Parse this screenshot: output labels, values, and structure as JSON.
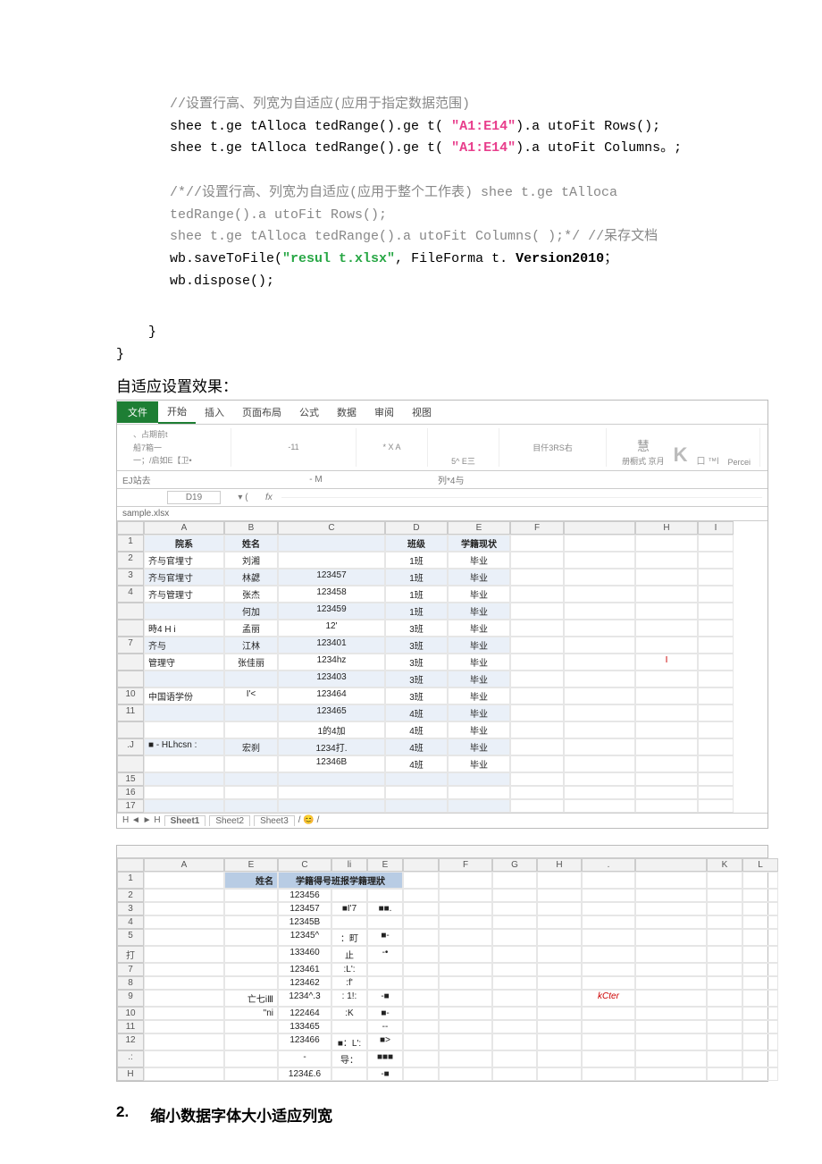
{
  "code": {
    "c1": "//设置行高、列宽为自适应(应用于指定数据范围)",
    "c2a": "shee t.ge tAlloca tedRange().ge t( ",
    "c2s": "\"A1:E14\"",
    "c2b": ").a utoFit Rows();",
    "c3a": "shee t.ge tAlloca tedRange().ge t( ",
    "c3s": "\"A1:E14\"",
    "c3b": ").a utoFit Columns。;",
    "c4a": "/*//设置行高、列宽为自适应(应用于整个工作表) shee t.ge tAlloca",
    "c4b": "tedRange().a utoFit Rows();",
    "c4c": "shee t.ge tAlloca tedRange().a utoFit Columns( );*/",
    "c4d": " //呆存文档",
    "c5a": "wb.saveToFile(",
    "c5s": "\"resul t.xlsx\"",
    "c5b": ", FileForma t. ",
    "c5c": "Version2010",
    "c5d": "；",
    "c6": "wb.dispose();",
    "brace1": "    }",
    "brace2": "}"
  },
  "effect_title": "自适应设置效果：",
  "ribbon": {
    "tabs": [
      "文件",
      "开始",
      "插入",
      "页面布局",
      "公式",
      "数据",
      "审阅",
      "视图"
    ],
    "grp1a": "、占期前t",
    "grp1b": "船7箱一",
    "grp1c": "一；/启如E【卫•",
    "font_size": "-11",
    "bold_marker": "* X A",
    "center": "5^ E三",
    "right1": "目仟3RS右",
    "style1": "慧",
    "styleK": "K",
    "style2": "册橱式  京月",
    "percei": "Percei",
    "little_sq": "口 ™l"
  },
  "fxrow": {
    "left": "EJ站去",
    "mid": "- M",
    "right": "列*4与"
  },
  "namebox": "D19",
  "fx_symbol": "fx",
  "filetab": "sample.xlsx",
  "grid1": {
    "cols": [
      "",
      "A",
      "B",
      "C",
      "D",
      "E",
      "F",
      "",
      "H",
      "I"
    ],
    "rows": [
      {
        "n": "1",
        "a": "院系",
        "b": "姓名",
        "c": "",
        "d": "班级",
        "e": "学籍现状",
        "hdr": true
      },
      {
        "n": "2",
        "a": "齐与官埋寸",
        "b": "刘湘",
        "c": "",
        "d": "1班",
        "e": "毕业"
      },
      {
        "n": "3",
        "a": "齐与官埋寸",
        "b": "林勰",
        "c": "123457",
        "d": "1班",
        "e": "毕业"
      },
      {
        "n": "4",
        "a": "齐与管理寸",
        "b": "张杰",
        "c": "123458",
        "d": "1班",
        "e": "毕业"
      },
      {
        "n": "",
        "a": "",
        "b": "何加",
        "c": "123459",
        "d": "1班",
        "e": "毕业"
      },
      {
        "n": "",
        "a": "時4 H    i",
        "b": "孟丽",
        "c": "12'",
        "d": "3班",
        "e": "毕业"
      },
      {
        "n": "7",
        "a": "齐与",
        "b": "江林",
        "c": "123401",
        "d": "3班",
        "e": "毕业"
      },
      {
        "n": "",
        "a": "管理守",
        "b": "张佳丽",
        "c": "1234hz",
        "d": "3班",
        "e": "毕业"
      },
      {
        "n": "",
        "a": "",
        "b": "",
        "c": "123403",
        "d": "3班",
        "e": "毕业"
      },
      {
        "n": "10",
        "a": "中国语学份",
        "b": "I'<",
        "c": "123464",
        "d": "3班",
        "e": "毕业"
      },
      {
        "n": "11",
        "a": "",
        "b": "",
        "c": "123465",
        "d": "4班",
        "e": "毕业"
      },
      {
        "n": "",
        "a": "",
        "b": "",
        "c": "1的4加",
        "d": "4班",
        "e": "毕业"
      },
      {
        "n": ".J",
        "a": "■ - HLhcsn :",
        "b": "宏刹",
        "c": "1234打.",
        "d": "4班",
        "e": "毕业"
      },
      {
        "n": "",
        "a": "",
        "b": "",
        "c": "12346B",
        "d": "4班",
        "e": "毕业"
      },
      {
        "n": "15",
        "a": "",
        "b": "",
        "c": "",
        "d": "",
        "e": ""
      },
      {
        "n": "16",
        "a": "",
        "b": "",
        "c": "",
        "d": "",
        "e": ""
      },
      {
        "n": "17",
        "a": "",
        "b": "",
        "c": "",
        "d": "",
        "e": ""
      }
    ],
    "redmark": "I"
  },
  "sheets": {
    "nav": "H ◄ ► H",
    "tabs": [
      "Sheet1",
      "Sheet2",
      "Sheet3"
    ]
  },
  "grid2": {
    "cols": [
      "",
      "A",
      "E",
      "C",
      "li",
      "E",
      "",
      "F",
      "G",
      "H",
      ".",
      "",
      "K",
      "L"
    ],
    "rows": [
      {
        "n": "1",
        "b": "姓名",
        "c": "学籍得号班报学籍理狀",
        "hdr": true
      },
      {
        "n": "2",
        "c": "123456",
        "d": "",
        "e": ""
      },
      {
        "n": "3",
        "c": "123457",
        "d": "■I'7",
        "e": "■■."
      },
      {
        "n": "4",
        "c": "12345B",
        "d": "",
        "e": ""
      },
      {
        "n": "5",
        "c": "12345^",
        "d": "：町",
        "e": "■-"
      },
      {
        "n": "打",
        "c": "133460",
        "d": "止",
        "e": "-•"
      },
      {
        "n": "7",
        "c": "123461",
        "d": ":L':",
        "e": ""
      },
      {
        "n": "8",
        "c": "123462",
        "d": ":f'",
        "e": ""
      },
      {
        "n": "9",
        "b": "亡七iⅢ",
        "c": "1234^.3",
        "d": ": 1!:",
        "e": "-■"
      },
      {
        "n": "10",
        "b": "\"ni",
        "c": "122464",
        "d": ":K",
        "e": "■-"
      },
      {
        "n": "11",
        "c": "133465",
        "d": "",
        "e": "--"
      },
      {
        "n": "12",
        "c": "123466",
        "d": "■：L':",
        "e": "■>"
      },
      {
        "n": ".:",
        "c": "-",
        "d": "导：",
        "e": "■■■"
      },
      {
        "n": "H",
        "c": "1234£.6",
        "d": "",
        "e": "-■"
      }
    ],
    "kcter": "kCter"
  },
  "heading2": {
    "num": "2.",
    "text": "缩小数据字体大小适应列宽"
  }
}
